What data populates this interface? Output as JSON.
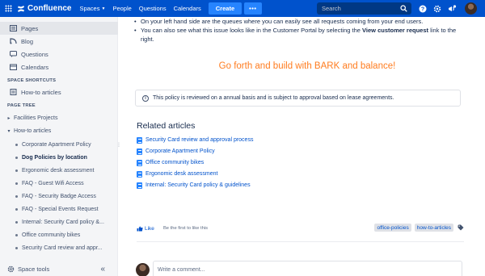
{
  "topbar": {
    "app_name": "Confluence",
    "nav": [
      {
        "label": "Spaces",
        "has_dropdown": true
      },
      {
        "label": "People",
        "has_dropdown": false
      },
      {
        "label": "Questions",
        "has_dropdown": false
      },
      {
        "label": "Calendars",
        "has_dropdown": false
      }
    ],
    "create_label": "Create",
    "more_label": "•••",
    "search_placeholder": "Search",
    "icons": [
      "help-icon",
      "settings-icon",
      "notifications-icon"
    ],
    "brand_color": "#0052cc"
  },
  "sidebar": {
    "items": [
      {
        "label": "Pages",
        "icon": "pages-icon",
        "active": true
      },
      {
        "label": "Blog",
        "icon": "blog-icon",
        "active": false
      },
      {
        "label": "Questions",
        "icon": "questions-icon",
        "active": false
      },
      {
        "label": "Calendars",
        "icon": "calendar-icon",
        "active": false
      }
    ],
    "shortcuts_heading": "SPACE SHORTCUTS",
    "shortcuts": [
      {
        "label": "How-to articles",
        "icon": "article-icon"
      }
    ],
    "tree_heading": "PAGE TREE",
    "tree": [
      {
        "label": "Facilities Projects",
        "level": 0,
        "expanded": false
      },
      {
        "label": "How-to articles",
        "level": 0,
        "expanded": true
      },
      {
        "label": "Corporate Apartment Policy",
        "level": 1
      },
      {
        "label": "Dog Policies by location",
        "level": 1,
        "current": true
      },
      {
        "label": "Ergonomic desk assessment",
        "level": 1
      },
      {
        "label": "FAQ - Guest Wifi Access",
        "level": 1
      },
      {
        "label": "FAQ - Security Badge Access",
        "level": 1
      },
      {
        "label": "FAQ - Special Events Request",
        "level": 1
      },
      {
        "label": "Internal: Security Card policy &...",
        "level": 1
      },
      {
        "label": "Office community bikes",
        "level": 1
      },
      {
        "label": "Security Card review and appr...",
        "level": 1
      }
    ],
    "footer_label": "Space tools",
    "collapse_label": "«"
  },
  "content": {
    "bullets": [
      "On your left hand side are the queues where you can easily see all requests coming from your end users.",
      {
        "before": "You can also see what this issue looks like in the Customer Portal by selecting the ",
        "bold": "View customer request",
        "after": " link to the right."
      }
    ],
    "headline": "Go forth and build with BARK and balance!",
    "headline_color": "#ff7c1f",
    "info_panel": "This policy is reviewed on a annual basis and is subject to approval based on lease agreements.",
    "related_title": "Related articles",
    "related": [
      "Security Card review and approval process",
      "Corporate Apartment Policy",
      "Office community bikes",
      "Ergonomic desk assessment",
      "Internal: Security Card policy & guidelines"
    ],
    "like_label": "Like",
    "like_note": "Be the first to like this",
    "labels": [
      "office-policies",
      "how-to-articles"
    ],
    "comment_placeholder": "Write a comment..."
  }
}
